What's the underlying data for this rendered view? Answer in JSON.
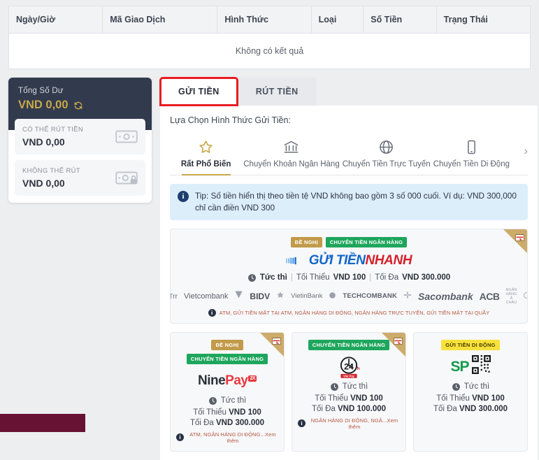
{
  "transactions": {
    "columns": [
      "Ngày/Giờ",
      "Mã Giao Dịch",
      "Hình Thức",
      "Loại",
      "Số Tiền",
      "Trạng Thái"
    ],
    "empty_text": "Không có kết quả"
  },
  "balance": {
    "total_label": "Tổng Số Dư",
    "total_value": "VND 0,00",
    "refresh_icon": "refresh-icon",
    "cards": [
      {
        "label": "CÓ THỂ RÚT TIỀN",
        "value": "VND 0,00",
        "icon": "banknote-icon"
      },
      {
        "label": "KHÔNG THỂ RÚT",
        "value": "VND 0,00",
        "icon": "banknote-lock-icon"
      }
    ]
  },
  "tabs": [
    {
      "label": "GỬI TIỀN",
      "active": true
    },
    {
      "label": "RÚT TIỀN",
      "active": false
    }
  ],
  "panel": {
    "title": "Lựa Chọn Hình Thức Gửi Tiền:",
    "next_arrow": "›"
  },
  "categories": [
    {
      "label": "Rất Phổ Biến",
      "icon": "star-icon",
      "active": true
    },
    {
      "label": "Chuyển Khoản Ngân Hàng",
      "icon": "bank-icon",
      "active": false
    },
    {
      "label": "Chuyển Tiền Trực Tuyến",
      "icon": "globe-icon",
      "active": false
    },
    {
      "label": "Chuyển Tiền Di Động",
      "icon": "mobile-icon",
      "active": false
    }
  ],
  "tip": {
    "icon": "info-icon",
    "text": "Tip: Số tiền hiển thị theo tiền tệ VND không bao gồm 3 số 000 cuối. Ví dụ: VND 300,000 chỉ cần điền VND 300"
  },
  "featured": {
    "badges": [
      {
        "text": "ĐỀ NGHỊ",
        "style": "gold"
      },
      {
        "text": "CHUYỂN TIỀN NGÂN HÀNG",
        "style": "green"
      }
    ],
    "logo_primary": "GỬI TIỀN",
    "logo_secondary": "NHANH",
    "speed": "Tức thì",
    "min_label": "Tối Thiểu",
    "min_value": "VND 100",
    "max_label": "Tối Đa",
    "max_value": "VND 300.000",
    "banks": [
      "iTrr",
      "Vietcombank",
      "BIDV",
      "VietinBank",
      "TECHCOMBANK",
      "Sacombank",
      "ACB"
    ],
    "acb_sub": "NGÂN HÀNG Á CHÂU",
    "footnote": "ATM, GỬI TIỀN MẶT TẠI ATM, NGÂN HÀNG DI ĐỘNG, NGÂN HÀNG TRỰC TUYẾN, GỬI TIỀN MẶT TẠI QUẦY",
    "corner_icon": "card-ribbon-icon"
  },
  "methods": [
    {
      "badges": [
        {
          "text": "ĐỀ NGHỊ",
          "style": "gold"
        },
        {
          "text": "CHUYỂN TIỀN NGÂN HÀNG",
          "style": "green"
        }
      ],
      "logo": "NinePay",
      "logo_sup": "2X",
      "speed": "Tức thì",
      "min_label": "Tối Thiểu",
      "min_value": "VND 100",
      "max_label": "Tối Đa",
      "max_value": "VND 300.000",
      "footnote": "ATM, NGÂN HÀNG DI ĐỘNG...Xem thêm",
      "corner_icon": "card-ribbon-icon"
    },
    {
      "badges": [
        {
          "text": "CHUYỂN TIỀN NGÂN HÀNG",
          "style": "green"
        }
      ],
      "logo": "24h",
      "logo_sub": "Viet Pay",
      "speed": "Tức thì",
      "min_label": "Tối Thiểu",
      "min_value": "VND 100",
      "max_label": "Tối Đa",
      "max_value": "VND 100.000",
      "footnote": "NGÂN HÀNG DI ĐỘNG, NGÂ...Xem thêm",
      "corner_icon": "card-ribbon-icon"
    },
    {
      "badges": [
        {
          "text": "GỬI TIỀN DI ĐỘNG",
          "style": "yellow"
        }
      ],
      "logo": "SP",
      "logo_icon": "qr-code-icon",
      "speed": "Tức thì",
      "min_label": "Tối Thiểu",
      "min_value": "VND 100",
      "max_label": "Tối Đa",
      "max_value": "VND 300.000",
      "footnote": "",
      "corner_icon": ""
    }
  ],
  "colors": {
    "navy": "#323a4d",
    "gold": "#c8a84b",
    "active_tab_outline": "#e81c23",
    "green_badge": "#1ea65c",
    "yellow_badge": "#f7e13a",
    "tip_bg": "#ddeefb",
    "maroon_bar": "#671233"
  }
}
